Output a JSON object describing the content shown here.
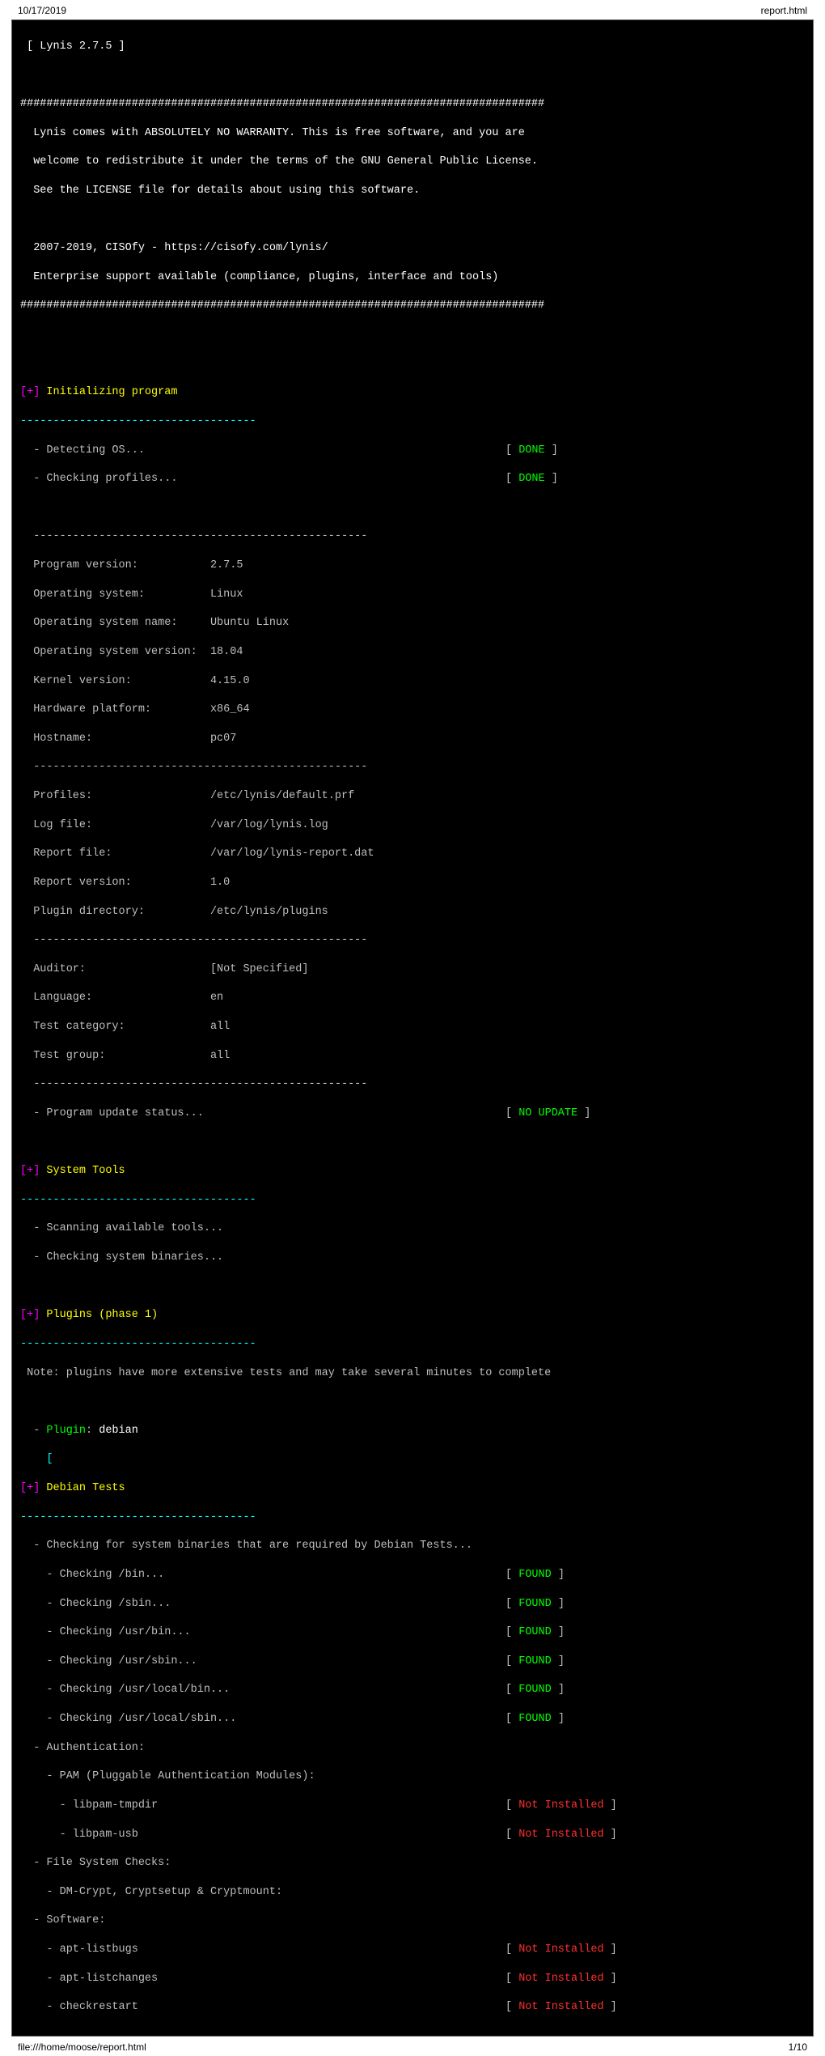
{
  "header": {
    "date": "10/17/2019",
    "title": "report.html"
  },
  "footer": {
    "path": "file:///home/moose/report.html",
    "page": "1/10"
  },
  "banner": {
    "title": "[ Lynis 2.7.5 ]",
    "hashes": "################################################################################",
    "l1": "  Lynis comes with ABSOLUTELY NO WARRANTY. This is free software, and you are",
    "l2": "  welcome to redistribute it under the terms of the GNU General Public License.",
    "l3": "  See the LICENSE file for details about using this software.",
    "l4": "  2007-2019, CISOfy - https://cisofy.com/lynis/",
    "l5": "  Enterprise support available (compliance, plugins, interface and tools)"
  },
  "sections": {
    "init": "Initializing program",
    "systools": "System Tools",
    "plugins1": "Plugins (phase 1)",
    "debian": "Debian Tests"
  },
  "dash36": "------------------------------------",
  "dash53": "  ---------------------------------------------------",
  "init": {
    "detect_os": "- Detecting OS...",
    "check_profiles": "- Checking profiles...",
    "done": "DONE"
  },
  "sysinfo": {
    "program_version_l": "  Program version:           ",
    "program_version_v": "2.7.5",
    "os_l": "  Operating system:          ",
    "os_v": "Linux",
    "osname_l": "  Operating system name:     ",
    "osname_v": "Ubuntu Linux",
    "osver_l": "  Operating system version:  ",
    "osver_v": "18.04",
    "kernel_l": "  Kernel version:            ",
    "kernel_v": "4.15.0",
    "hw_l": "  Hardware platform:         ",
    "hw_v": "x86_64",
    "host_l": "  Hostname:                  ",
    "host_v": "pc07",
    "profiles_l": "  Profiles:                  ",
    "profiles_v": "/etc/lynis/default.prf",
    "logfile_l": "  Log file:                  ",
    "logfile_v": "/var/log/lynis.log",
    "report_l": "  Report file:               ",
    "report_v": "/var/log/lynis-report.dat",
    "reportver_l": "  Report version:            ",
    "reportver_v": "1.0",
    "plugindir_l": "  Plugin directory:          ",
    "plugindir_v": "/etc/lynis/plugins",
    "auditor_l": "  Auditor:                   ",
    "auditor_v": "[Not Specified]",
    "lang_l": "  Language:                  ",
    "lang_v": "en",
    "testcat_l": "  Test category:             ",
    "testcat_v": "all",
    "testgrp_l": "  Test group:                ",
    "testgrp_v": "all",
    "update_l": "  - Program update status... ",
    "no_update": "NO UPDATE"
  },
  "systools": {
    "scan": "  - Scanning available tools...",
    "check": "  - Checking system binaries..."
  },
  "plugins": {
    "note": " Note: plugins have more extensive tests and may take several minutes to complete",
    "plugin_pre": "  - ",
    "plugin_word": "Plugin",
    "plugin_sep": ": ",
    "plugin_name": "debian",
    "bracket": "    ["
  },
  "debian": {
    "check_sysbin": "  - Checking for system binaries that are required by Debian Tests...",
    "bin_checks": [
      {
        "l": "    - Checking /bin...    "
      },
      {
        "l": "    - Checking /sbin...   "
      },
      {
        "l": "    - Checking /usr/bin..."
      },
      {
        "l": "    - Checking /usr/sbin..."
      },
      {
        "l": "    - Checking /usr/local/bin..."
      },
      {
        "l": "    - Checking /usr/local/sbin..."
      }
    ],
    "found": "FOUND",
    "auth": "  - Authentication:",
    "pam": "    - PAM (Pluggable Authentication Modules):",
    "libpam_tmpdir": "      - libpam-tmpdir",
    "libpam_usb": "      - libpam-usb",
    "not_installed": "Not Installed",
    "fsc": "  - File System Checks:",
    "dmcrypt": "    - DM-Crypt, Cryptsetup & Cryptmount:",
    "software": "  - Software:",
    "apt_listbugs": "    - apt-listbugs",
    "apt_listchanges": "    - apt-listchanges",
    "checkrestart": "    - checkrestart"
  }
}
